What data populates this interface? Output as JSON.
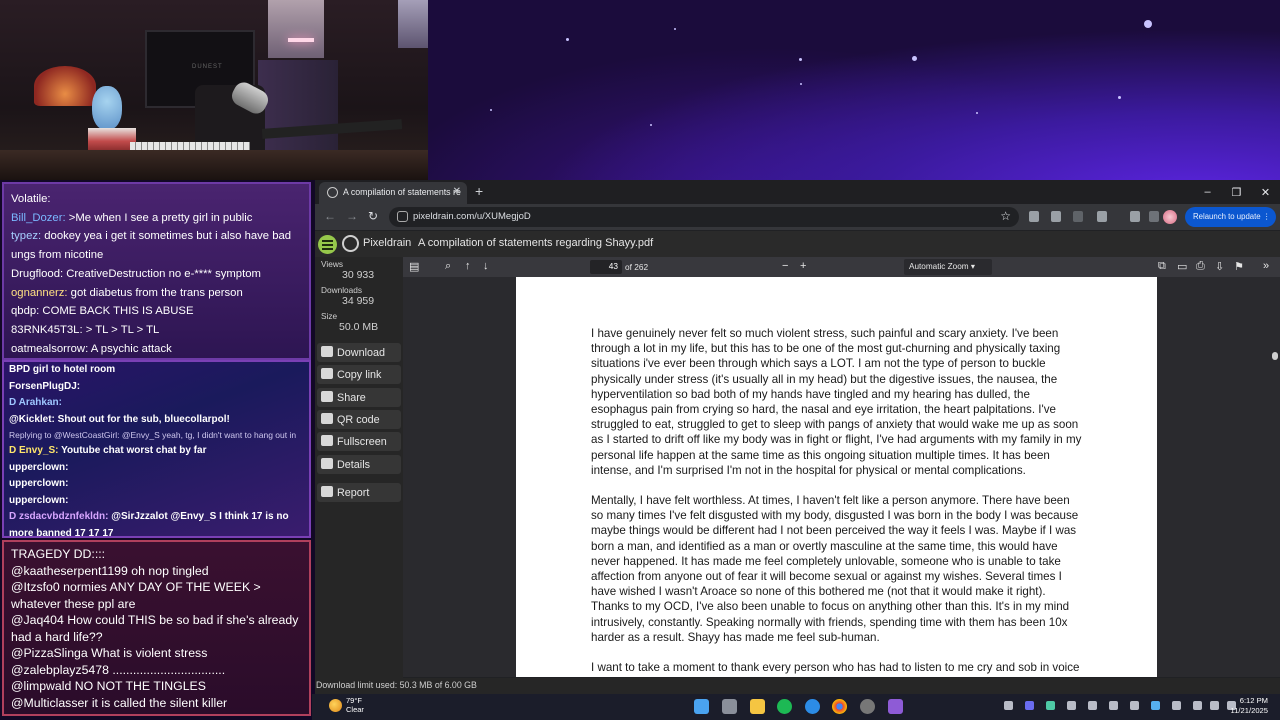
{
  "chat_top": [
    {
      "user": "Volatile:",
      "text": "",
      "color": "#ffffff"
    },
    {
      "user": "Bill_Dozer:",
      "text": " >Me when I see a pretty girl in public",
      "color": "#7ab8ff"
    },
    {
      "user": "typez:",
      "text": " dookey yea i get it sometimes but i also have bad ungs from nicotine",
      "color": "#a7d0ff"
    },
    {
      "user": "Drugflood:",
      "text": " CreativeDestruction no e-**** symptom",
      "color": "#ffffff"
    },
    {
      "user": "ognannerz:",
      "text": " got diabetus from the trans person",
      "color": "#ffe082"
    },
    {
      "user": "qbdp:",
      "text": " COME BACK  THIS IS ABUSE",
      "color": "#ffffff"
    },
    {
      "user": "83RNK45T3L:",
      "text": " > TL  > TL  > TL",
      "color": "#ffffff"
    },
    {
      "user": "oatmealsorrow:",
      "text": " A psychic attack",
      "color": "#ffffff"
    }
  ],
  "chat_mid": [
    {
      "user": "BPD girl to hotel room",
      "text": "",
      "color": "#ffffff"
    },
    {
      "user": "ForsenPlugDJ:",
      "text": "",
      "color": "#ffffff"
    },
    {
      "user": "D Arahkan:",
      "text": "",
      "color": "#9ec6ff"
    },
    {
      "user": "@Kicklet:",
      "text": " Shout out for the sub, bluecollarpol!",
      "color": "#ffffff"
    },
    {
      "user": "",
      "text": "Replying to @WestCoastGirl: @Envy_S yeah, tg, I didn't want to hang out in",
      "color": "#cfc8ef",
      "reply": true
    },
    {
      "user": "D Envy_S:",
      "text": " Youtube chat worst chat by far",
      "color": "#ffe66b"
    },
    {
      "user": "upperclown:",
      "text": "",
      "color": "#ffffff"
    },
    {
      "user": "upperclown:",
      "text": "",
      "color": "#ffffff"
    },
    {
      "user": "upperclown:",
      "text": "",
      "color": "#ffffff"
    },
    {
      "user": "D zsdacvbdznfekldn:",
      "text": " @SirJzzalot @Envy_S I think 17 is no more banned 17 17 17",
      "color": "#d7a6ff"
    }
  ],
  "chat_bottom": [
    {
      "user": "TRAGEDY DD::::",
      "text": ""
    },
    {
      "user": "@kaatheserpent1199",
      "text": " oh nop tingled"
    },
    {
      "user": "@Itzsfo0",
      "text": " normies ANY DAY OF THE WEEK > whatever these ppl are"
    },
    {
      "user": "@Jaq404",
      "text": " How could THIS be so bad if she's already had a hard life??"
    },
    {
      "user": "@PizzaSlinga",
      "text": " What is violent stress"
    },
    {
      "user": "@zalebplayz5478",
      "text": " ................................."
    },
    {
      "user": "@limpwald",
      "text": " NO NOT THE TINGLES"
    },
    {
      "user": "@Multiclasser",
      "text": " it is called the silent killer"
    }
  ],
  "browser": {
    "tab_title": "A compilation of statements re",
    "url": "pixeldrain.com/u/XUMegjoD",
    "relaunch": "Relaunch to update"
  },
  "pixeldrain": {
    "brand": "Pixeldrain",
    "file_title": "A compilation of statements regarding Shayy.pdf",
    "views_label": "Views",
    "views": "30 933",
    "downloads_label": "Downloads",
    "downloads": "34 959",
    "size_label": "Size",
    "size": "50.0 MB",
    "buttons": [
      "Download",
      "Copy link",
      "Share",
      "QR code",
      "Fullscreen",
      "Details",
      "Report"
    ],
    "page": "43",
    "page_of": "of 262",
    "zoom": "Automatic Zoom",
    "download_limit": "Download limit used: 50.3 MB of 6.00 GB"
  },
  "pdf_paragraphs": [
    "I have genuinely never felt so much violent stress, such painful and scary anxiety. I've been through a lot in my life, but this has to be one of the most gut-churning and physically taxing situations i've ever been through which says a LOT. I am not the type of person to buckle physically under stress (it's usually all in my head) but the digestive issues, the nausea, the hyperventilation so bad both of my hands have tingled and my hearing has dulled, the esophagus pain from crying so hard, the nasal and eye irritation, the heart palpitations. I've struggled to eat, struggled to get to sleep with pangs of anxiety that would wake me up as soon as I started to drift off like my body was in fight or flight, I've had arguments with my family in my personal life happen at the same time as this ongoing situation multiple times. It has been intense, and I'm surprised I'm not in the hospital for physical or mental complications.",
    "Mentally, I have felt worthless. At times, I haven't felt like a person anymore. There have been so many times I've felt disgusted with my body, disgusted I was born in the body I was because maybe things would be different had I not been perceived the way it feels I was. Maybe if I was born a man, and identified as a man or overtly masculine at the same time, this would have never happened. It has made me feel completely unlovable, someone who is unable to take affection from anyone out of fear it will become sexual or against my wishes. Several times I have wished I wasn't Aroace so none of this bothered me (not that it would make it right). Thanks to my OCD, I've also been unable to focus on anything other than this. It's in my mind intrusively, constantly. Speaking normally with friends, spending time with them has been 10x harder as a result. Shayy has made me feel sub-human.",
    "I want to take a moment to thank every person who has had to listen to me cry and sob in voice"
  ],
  "taskbar": {
    "temp": "79°F",
    "weather": "Clear",
    "time": "6:12 PM",
    "date": "11/21/2025"
  }
}
